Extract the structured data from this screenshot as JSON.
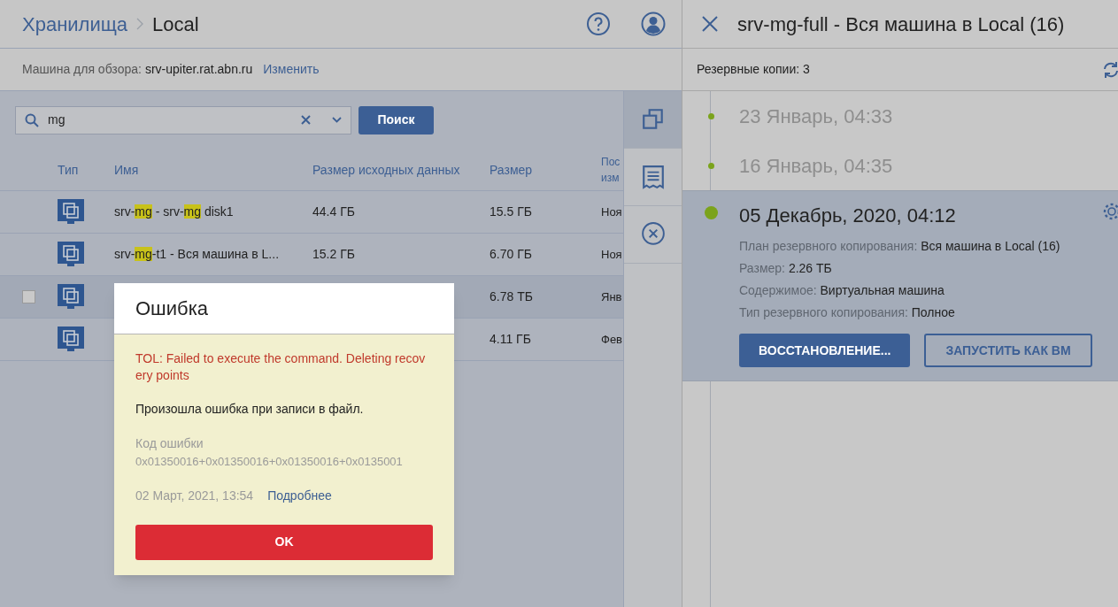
{
  "header": {
    "breadcrumb": [
      {
        "label": "Хранилища",
        "link": true
      },
      {
        "label": "Local",
        "link": false
      }
    ]
  },
  "machine_bar": {
    "label": "Машина для обзора:",
    "value": "srv-upiter.rat.abn.ru",
    "action": "Изменить"
  },
  "search": {
    "value": "mg",
    "button": "Поиск"
  },
  "tools": [
    {
      "kind": "copies",
      "selected": true
    },
    {
      "kind": "report",
      "selected": false
    },
    {
      "kind": "cancel",
      "selected": false
    }
  ],
  "table": {
    "columns": [
      "Тип",
      "Имя",
      "Размер исходных данных",
      "Размер",
      "Пос изм"
    ],
    "rows": [
      {
        "selected": false,
        "name": [
          {
            "text": "srv-",
            "match": false
          },
          {
            "text": "mg",
            "match": true
          },
          {
            "text": " - srv-",
            "match": false
          },
          {
            "text": "mg",
            "match": true
          },
          {
            "text": " disk1",
            "match": false
          }
        ],
        "source_size": "44.4 ГБ",
        "size": "15.5 ГБ",
        "column_5": "Ноя"
      },
      {
        "selected": false,
        "name": [
          {
            "text": "srv-",
            "match": false
          },
          {
            "text": "mg",
            "match": true
          },
          {
            "text": "-t1 - Вся машина в L...",
            "match": false
          }
        ],
        "source_size": "15.2 ГБ",
        "size": "6.70 ГБ",
        "column_5": "Ноя"
      },
      {
        "selected": true,
        "checked": false,
        "size": "6.78 ТБ",
        "column_5": "Янв"
      },
      {
        "selected": false,
        "size": "4.11 ГБ",
        "column_5": "Фев"
      }
    ]
  },
  "dialog": {
    "title": "Ошибка",
    "error": "TOL: Failed to execute the command. Deleting recovery points",
    "message": "Произошла ошибка при записи в файл.",
    "code_label": "Код ошибки",
    "code": "0x01350016+0x01350016+0x01350016+0x0135001",
    "date": "02 Март, 2021, 13:54",
    "link": "Подробнее",
    "button": "OK"
  },
  "details_panel": {
    "title": "srv-mg-full - Вся машина в Local (16)",
    "count_label": "Резервные копии: 3",
    "backups": [
      {
        "date": "23 Январь, 04:33",
        "selected": false
      },
      {
        "date": "16 Январь, 04:35",
        "selected": false
      },
      {
        "date": "05 Декабрь, 2020, 04:12",
        "selected": true,
        "details": [
          {
            "label": "План резервного копирования:",
            "value": "Вся машина в Local (16)"
          },
          {
            "label": "Размер:",
            "value": "2.26 ТБ"
          },
          {
            "label": "Содержимое:",
            "value": "Виртуальная машина"
          },
          {
            "label": "Тип резервного копирования:",
            "value": "Полное"
          }
        ],
        "actions": [
          {
            "label": "ВОССТАНОВЛЕНИЕ...",
            "primary": true
          },
          {
            "label": "ЗАПУСТИТЬ КАК ВМ",
            "primary": false
          }
        ]
      }
    ]
  }
}
